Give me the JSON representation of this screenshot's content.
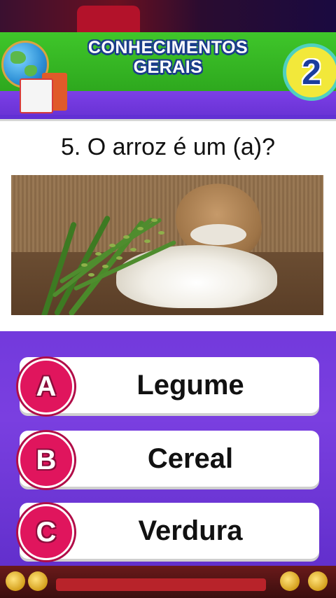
{
  "header": {
    "title_line1": "CONHECIMENTOS",
    "title_line2": "GERAIS",
    "level_number": "2"
  },
  "question": {
    "text": "5. O arroz é um (a)?"
  },
  "answers": [
    {
      "letter": "A",
      "label": "Legume"
    },
    {
      "letter": "B",
      "label": "Cereal"
    },
    {
      "letter": "C",
      "label": "Verdura"
    }
  ],
  "colors": {
    "banner_green": "#2ea81e",
    "background_purple": "#6b34d8",
    "badge_pink": "#e0155d",
    "title_outline": "#1b3d8a"
  },
  "icons": [
    "globe-icon",
    "book-icon",
    "clock-icon"
  ]
}
